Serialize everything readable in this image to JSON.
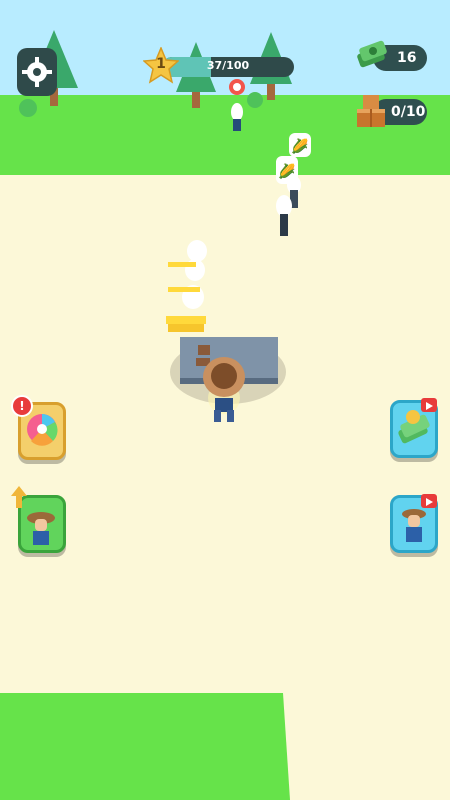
{
  "hud": {
    "level": "1",
    "xp_text": "37/100",
    "xp_progress": 0.37,
    "cash": "16",
    "crates": "0/10"
  },
  "icons": {
    "settings": "gear-icon",
    "level": "star-icon",
    "cash": "cash-stack-icon",
    "crates": "crate-icon",
    "spin": "prize-wheel-icon",
    "upgrade_farmer": "farmer-upgrade-icon",
    "cash_video": "cash-video-reward-icon",
    "helper_video": "helper-video-reward-icon",
    "alert": "exclamation-icon",
    "corn": "corn-icon"
  },
  "colors": {
    "grass": "#66e34a",
    "ground": "#fcf8d8",
    "hud_dark": "#2f4a4a",
    "xp_fill": "#5fc4b6",
    "star": "#f5c542",
    "alert_red": "#e83b3b"
  }
}
